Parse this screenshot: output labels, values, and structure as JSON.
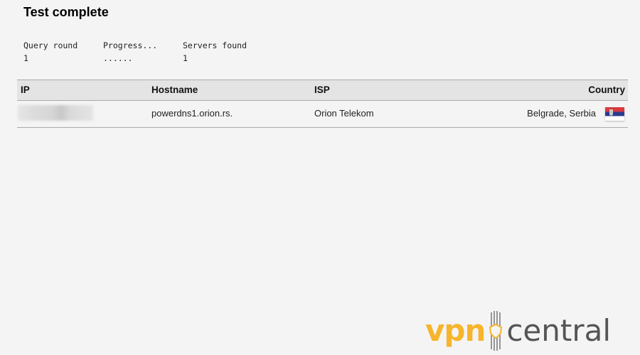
{
  "header": {
    "title": "Test complete"
  },
  "stats": [
    {
      "label": "Query round",
      "value": "1"
    },
    {
      "label": "Progress...",
      "value": "......"
    },
    {
      "label": "Servers found",
      "value": "1"
    }
  ],
  "table": {
    "columns": [
      "IP",
      "Hostname",
      "ISP",
      "Country"
    ],
    "rows": [
      {
        "ip": "",
        "hostname": "powerdns1.orion.rs.",
        "isp": "Orion Telekom",
        "country": "Belgrade, Serbia",
        "flag": "serbia-flag"
      }
    ]
  },
  "logo": {
    "part1": "vpn",
    "part2": "central",
    "accent": "#f7b52c",
    "secondary": "#555555"
  }
}
